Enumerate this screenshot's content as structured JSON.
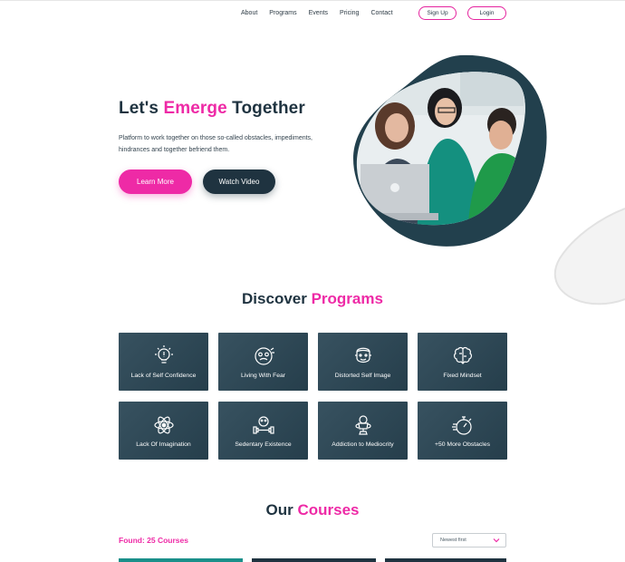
{
  "nav": {
    "links": [
      "About",
      "Programs",
      "Events",
      "Pricing",
      "Contact"
    ],
    "signup_label": "Sign Up",
    "login_label": "Login"
  },
  "hero": {
    "title_prefix": "Let's ",
    "title_highlight": "Emerge",
    "title_suffix": " Together",
    "description": "Platform to work together on those so-called obstacles, impediments, hindrances and together befriend them.",
    "learn_more_label": "Learn More",
    "watch_video_label": "Watch Video"
  },
  "programs": {
    "title_prefix": "Discover ",
    "title_highlight": "Programs",
    "cards": [
      {
        "label": "Lack of Self Confidence",
        "icon": "lightbulb-icon"
      },
      {
        "label": "Living With Fear",
        "icon": "fear-face-icon"
      },
      {
        "label": "Distorted Self Image",
        "icon": "face-icon"
      },
      {
        "label": "Fixed Mindset",
        "icon": "brain-icon"
      },
      {
        "label": "Lack Of Imagination",
        "icon": "atom-icon"
      },
      {
        "label": "Sedentary Existence",
        "icon": "dumbbell-icon"
      },
      {
        "label": "Addiction to Mediocrity",
        "icon": "trophy-icon"
      },
      {
        "label": "+50 More Obstacles",
        "icon": "stopwatch-icon"
      }
    ]
  },
  "courses": {
    "title_prefix": "Our ",
    "title_highlight": "Courses",
    "found_label": "Found: 25 Courses",
    "sort_value": "Newest first"
  },
  "colors": {
    "accent": "#ee2aa6",
    "dark": "#1f3340",
    "card": "#2b4756"
  }
}
